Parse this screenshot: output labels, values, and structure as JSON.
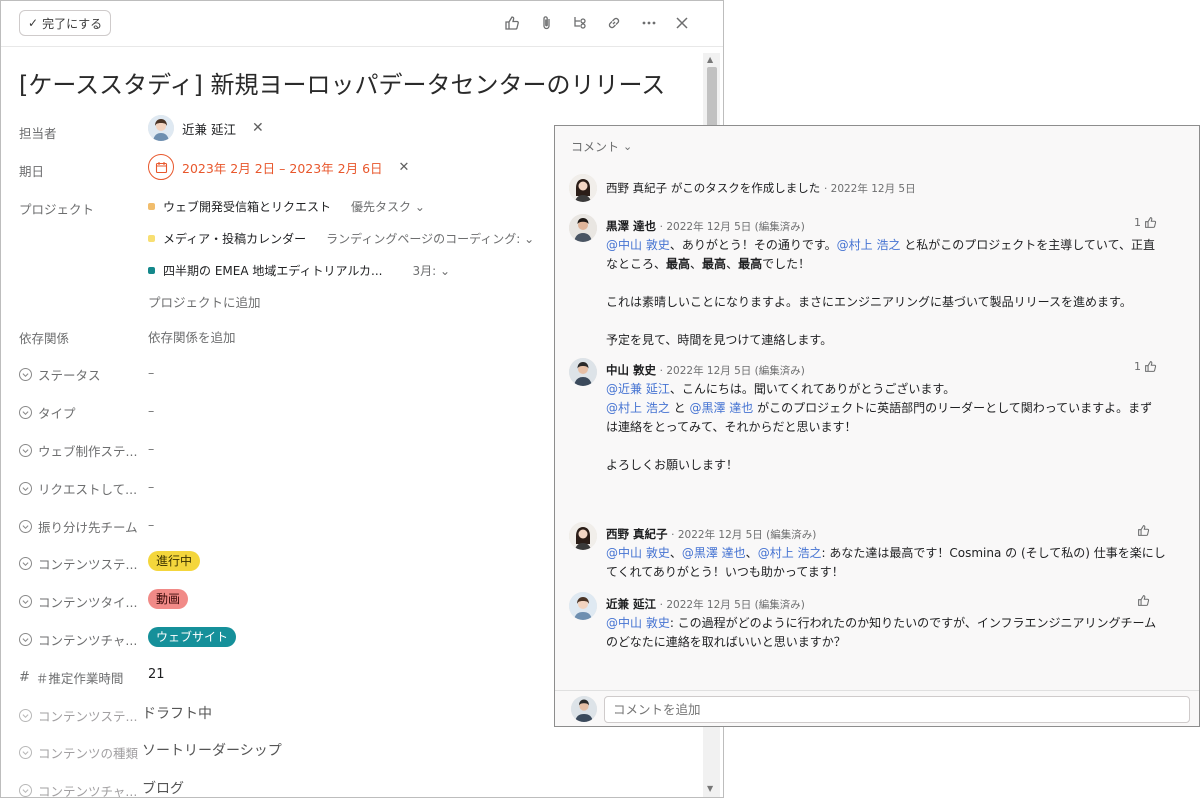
{
  "toolbar": {
    "complete_label": "完了にする",
    "icons": [
      "thumbs-up-icon",
      "paperclip-icon",
      "subtask-icon",
      "link-icon",
      "more-icon",
      "close-icon"
    ]
  },
  "task": {
    "title": "[ケーススタディ] 新規ヨーロッパデータセンターのリリース",
    "assignee_label": "担当者",
    "assignee_name": "近兼 延江",
    "due_label": "期日",
    "due_value": "2023年 2月 2日 – 2023年 2月 6日",
    "project_label": "プロジェクト",
    "projects": [
      {
        "name": "ウェブ開発受信箱とリクエスト",
        "section": "優先タスク",
        "color": "#f1bd6c"
      },
      {
        "name": "メディア・投稿カレンダー",
        "section": "ランディングページのコーディング:",
        "color": "#f8df72"
      },
      {
        "name": "四半期の EMEA 地域エディトリアルカ...",
        "section": "3月:",
        "color": "#14888b"
      }
    ],
    "add_project": "プロジェクトに追加",
    "dependency_label": "依存関係",
    "dependency_value": "依存関係を追加",
    "fields": [
      {
        "label": "ステータス",
        "value": "–"
      },
      {
        "label": "タイプ",
        "value": "–"
      },
      {
        "label": "ウェブ制作ステ...",
        "value": "–"
      },
      {
        "label": "リクエストして...",
        "value": "–"
      },
      {
        "label": "振り分け先チーム",
        "value": "–"
      },
      {
        "label": "コンテンツステ...",
        "value": "進行中",
        "pill_bg": "#f4d63c",
        "pill_fg": "#3b3200"
      },
      {
        "label": "コンテンツタイ...",
        "value": "動画",
        "pill_bg": "#f18a87",
        "pill_fg": "#3a0a09"
      },
      {
        "label": "コンテンツチャ...",
        "value": "ウェブサイト",
        "pill_bg": "#15909a",
        "pill_fg": "#ffffff"
      }
    ],
    "estimate_label": "＃推定作業時間",
    "estimate_value": "21",
    "muted_fields": [
      {
        "label": "コンテンツステ...",
        "value": "ドラフト中"
      },
      {
        "label": "コンテンツの種類",
        "value": "ソートリーダーシップ"
      },
      {
        "label": "コンテンツチャ...",
        "value": "ブログ"
      }
    ]
  },
  "comments": {
    "header": "コメント",
    "created_line": {
      "name": "西野 真紀子",
      "text": "がこのタスクを作成しました",
      "date": "· 2022年 12月 5日"
    },
    "entries": [
      {
        "name": "黒澤 達也",
        "meta": "· 2022年 12月 5日 (編集済み)",
        "likes": "1",
        "lines": [
          [
            {
              "m": "@中山 敦史"
            },
            {
              "t": "、ありがとう！その通りです。"
            },
            {
              "m": "@村上 浩之"
            },
            {
              "t": " と私がこのプロジェクトを主導していて、正直"
            }
          ],
          [
            {
              "t": "なところ、"
            },
            {
              "b": "最高"
            },
            {
              "t": "、"
            },
            {
              "b": "最高"
            },
            {
              "t": "、"
            },
            {
              "b": "最高"
            },
            {
              "t": "でした！"
            }
          ],
          [],
          [
            {
              "t": "これは素晴しいことになりますよ。まさにエンジニアリングに基づいて製品リリースを進めます。"
            }
          ],
          [],
          [
            {
              "t": "予定を見て、時間を見つけて連絡します。"
            }
          ]
        ]
      },
      {
        "name": "中山 敦史",
        "meta": "· 2022年 12月 5日 (編集済み)",
        "likes": "1",
        "lines": [
          [
            {
              "m": "@近兼 延江"
            },
            {
              "t": "、こんにちは。聞いてくれてありがとうございます。"
            }
          ],
          [
            {
              "m": "@村上 浩之"
            },
            {
              "t": " と "
            },
            {
              "m": "@黒澤 達也"
            },
            {
              "t": " がこのプロジェクトに英語部門のリーダーとして関わっていますよ。まず"
            }
          ],
          [
            {
              "t": "は連絡をとってみて、それからだと思います！"
            }
          ],
          [],
          [
            {
              "t": "よろしくお願いします！"
            }
          ]
        ]
      },
      {
        "name": "西野 真紀子",
        "meta": "· 2022年 12月 5日 (編集済み)",
        "likes": "",
        "lines": [
          [
            {
              "m": "@中山 敦史"
            },
            {
              "t": "、"
            },
            {
              "m": "@黒澤 達也"
            },
            {
              "t": "、"
            },
            {
              "m": "@村上 浩之"
            },
            {
              "t": ": あなた達は最高です！Cosmina の (そして私の) 仕事を楽にし"
            }
          ],
          [
            {
              "t": "てくれてありがとう！いつも助かってます！"
            }
          ]
        ]
      },
      {
        "name": "近兼 延江",
        "meta": "· 2022年 12月 5日 (編集済み)",
        "likes": "",
        "lines": [
          [
            {
              "m": "@中山 敦史"
            },
            {
              "t": ": この過程がどのように行われたのか知りたいのですが、インフラエンジニアリングチーム"
            }
          ],
          [
            {
              "t": "のどなたに連絡を取ればいいと思いますか？"
            }
          ]
        ]
      }
    ],
    "input_placeholder": "コメントを追加"
  },
  "colors": {
    "accent_red": "#e8572c",
    "mention_blue": "#4573d2"
  }
}
